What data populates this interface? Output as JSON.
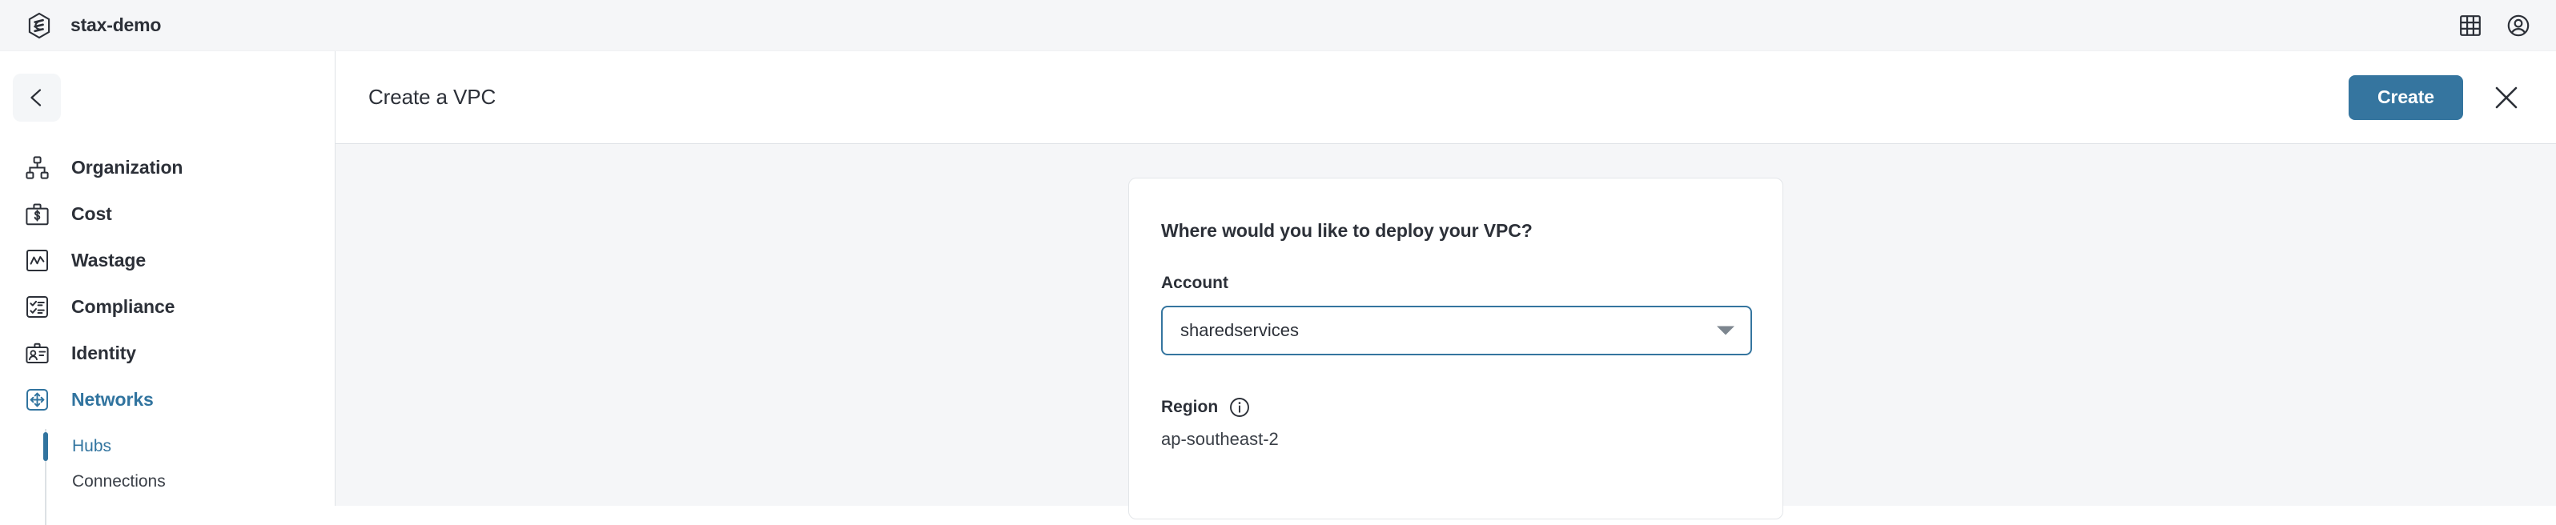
{
  "topbar": {
    "brand_name": "stax-demo",
    "logo_icon": "stax-hexagon-logo",
    "apps_icon": "grid-apps-icon",
    "account_icon": "user-account-icon"
  },
  "sidebar": {
    "back_icon": "chevron-left-icon",
    "items": [
      {
        "label": "Organization",
        "icon": "org-chart-icon",
        "active": false
      },
      {
        "label": "Cost",
        "icon": "briefcase-dollar-icon",
        "active": false
      },
      {
        "label": "Wastage",
        "icon": "chart-box-icon",
        "active": false
      },
      {
        "label": "Compliance",
        "icon": "checklist-box-icon",
        "active": false
      },
      {
        "label": "Identity",
        "icon": "id-card-icon",
        "active": false
      },
      {
        "label": "Networks",
        "icon": "move-arrows-box-icon",
        "active": true
      }
    ],
    "subitems": [
      {
        "label": "Hubs",
        "active": true
      },
      {
        "label": "Connections",
        "active": false
      }
    ]
  },
  "header": {
    "title": "Create a VPC",
    "create_label": "Create",
    "close_icon": "close-x-icon"
  },
  "form": {
    "heading": "Where would you like to deploy your VPC?",
    "account_label": "Account",
    "account_value": "sharedservices",
    "account_caret_icon": "chevron-down-icon",
    "region_label": "Region",
    "region_info_icon": "info-circle-icon",
    "region_value": "ap-southeast-2"
  },
  "colors": {
    "accent": "#35759f",
    "topbar_bg": "#f5f6f8",
    "content_bg": "#f5f6f8",
    "text": "#2c3038"
  }
}
